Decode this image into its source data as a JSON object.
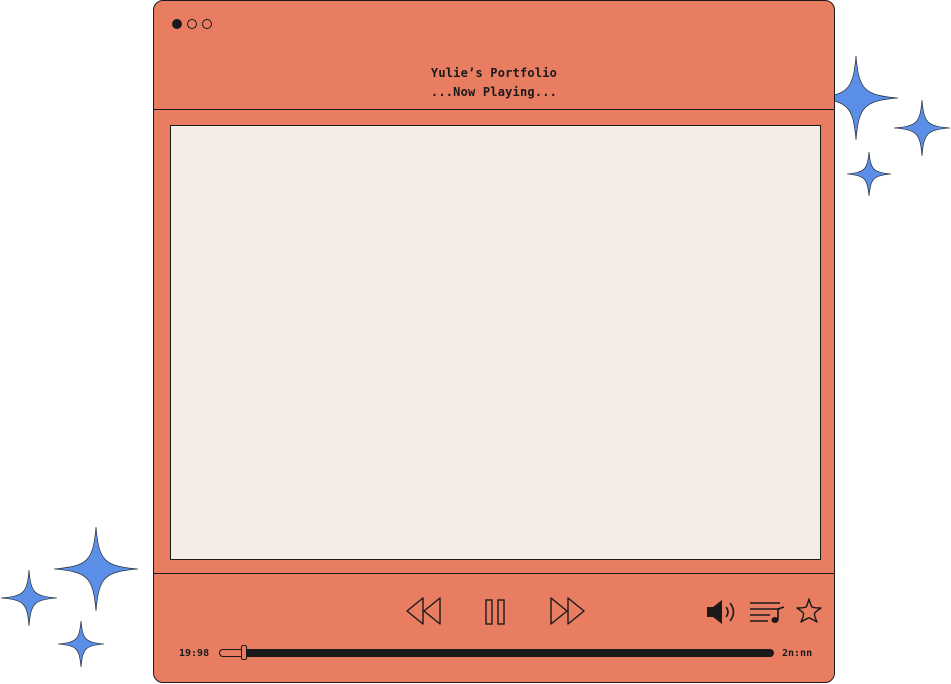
{
  "window": {
    "title": "Yulie’s Portfolio",
    "subtitle": "...Now Playing...",
    "traffic_lights": [
      "filled-dot",
      "empty-dot",
      "empty-dot"
    ]
  },
  "player": {
    "controls": [
      "rewind-icon",
      "pause-icon",
      "fast-forward-icon"
    ],
    "extras": [
      "volume-icon",
      "playlist-icon",
      "star-icon"
    ],
    "elapsed_time": "19:98",
    "total_time": "2n:nn",
    "progress": 0.045
  },
  "colors": {
    "window_bg": "#E97D62",
    "screen_bg": "#F5ECE8",
    "outline": "#1a1a1a",
    "sparkle": "#5B8EE6"
  }
}
